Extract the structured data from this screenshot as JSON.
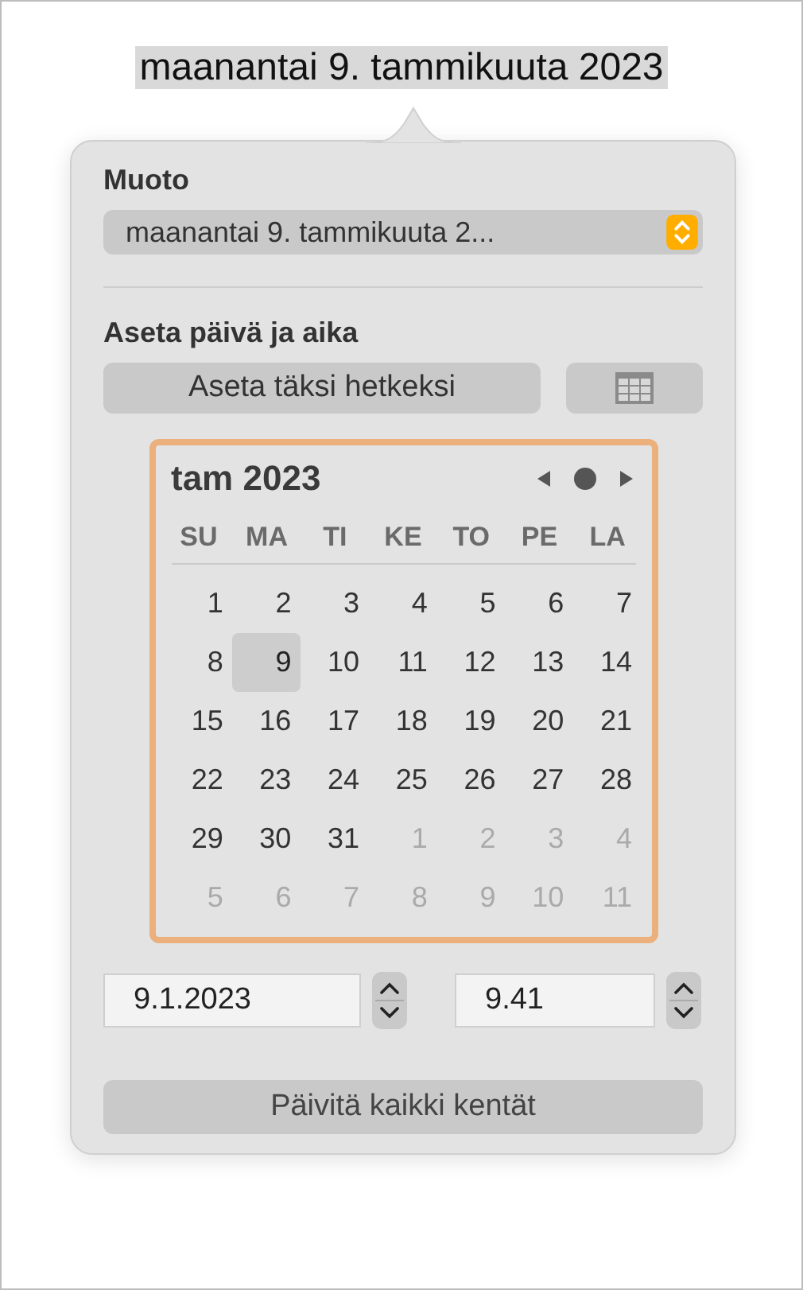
{
  "selected_text": "maanantai 9. tammikuuta 2023",
  "popover": {
    "format_label": "Muoto",
    "format_value": "maanantai 9. tammikuuta 2...",
    "set_label": "Aseta päivä ja aika",
    "now_button": "Aseta täksi hetkeksi",
    "calendar": {
      "month": "tam 2023",
      "weekdays": [
        "SU",
        "MA",
        "TI",
        "KE",
        "TO",
        "PE",
        "LA"
      ],
      "days": [
        {
          "label": "1",
          "muted": false,
          "selected": false
        },
        {
          "label": "2",
          "muted": false,
          "selected": false
        },
        {
          "label": "3",
          "muted": false,
          "selected": false
        },
        {
          "label": "4",
          "muted": false,
          "selected": false
        },
        {
          "label": "5",
          "muted": false,
          "selected": false
        },
        {
          "label": "6",
          "muted": false,
          "selected": false
        },
        {
          "label": "7",
          "muted": false,
          "selected": false
        },
        {
          "label": "8",
          "muted": false,
          "selected": false
        },
        {
          "label": "9",
          "muted": false,
          "selected": true
        },
        {
          "label": "10",
          "muted": false,
          "selected": false
        },
        {
          "label": "11",
          "muted": false,
          "selected": false
        },
        {
          "label": "12",
          "muted": false,
          "selected": false
        },
        {
          "label": "13",
          "muted": false,
          "selected": false
        },
        {
          "label": "14",
          "muted": false,
          "selected": false
        },
        {
          "label": "15",
          "muted": false,
          "selected": false
        },
        {
          "label": "16",
          "muted": false,
          "selected": false
        },
        {
          "label": "17",
          "muted": false,
          "selected": false
        },
        {
          "label": "18",
          "muted": false,
          "selected": false
        },
        {
          "label": "19",
          "muted": false,
          "selected": false
        },
        {
          "label": "20",
          "muted": false,
          "selected": false
        },
        {
          "label": "21",
          "muted": false,
          "selected": false
        },
        {
          "label": "22",
          "muted": false,
          "selected": false
        },
        {
          "label": "23",
          "muted": false,
          "selected": false
        },
        {
          "label": "24",
          "muted": false,
          "selected": false
        },
        {
          "label": "25",
          "muted": false,
          "selected": false
        },
        {
          "label": "26",
          "muted": false,
          "selected": false
        },
        {
          "label": "27",
          "muted": false,
          "selected": false
        },
        {
          "label": "28",
          "muted": false,
          "selected": false
        },
        {
          "label": "29",
          "muted": false,
          "selected": false
        },
        {
          "label": "30",
          "muted": false,
          "selected": false
        },
        {
          "label": "31",
          "muted": false,
          "selected": false
        },
        {
          "label": "1",
          "muted": true,
          "selected": false
        },
        {
          "label": "2",
          "muted": true,
          "selected": false
        },
        {
          "label": "3",
          "muted": true,
          "selected": false
        },
        {
          "label": "4",
          "muted": true,
          "selected": false
        },
        {
          "label": "5",
          "muted": true,
          "selected": false
        },
        {
          "label": "6",
          "muted": true,
          "selected": false
        },
        {
          "label": "7",
          "muted": true,
          "selected": false
        },
        {
          "label": "8",
          "muted": true,
          "selected": false
        },
        {
          "label": "9",
          "muted": true,
          "selected": false
        },
        {
          "label": "10",
          "muted": true,
          "selected": false
        },
        {
          "label": "11",
          "muted": true,
          "selected": false
        }
      ]
    },
    "date_value": "9.1.2023",
    "time_value": "9.41",
    "update_button": "Päivitä kaikki kentät"
  }
}
